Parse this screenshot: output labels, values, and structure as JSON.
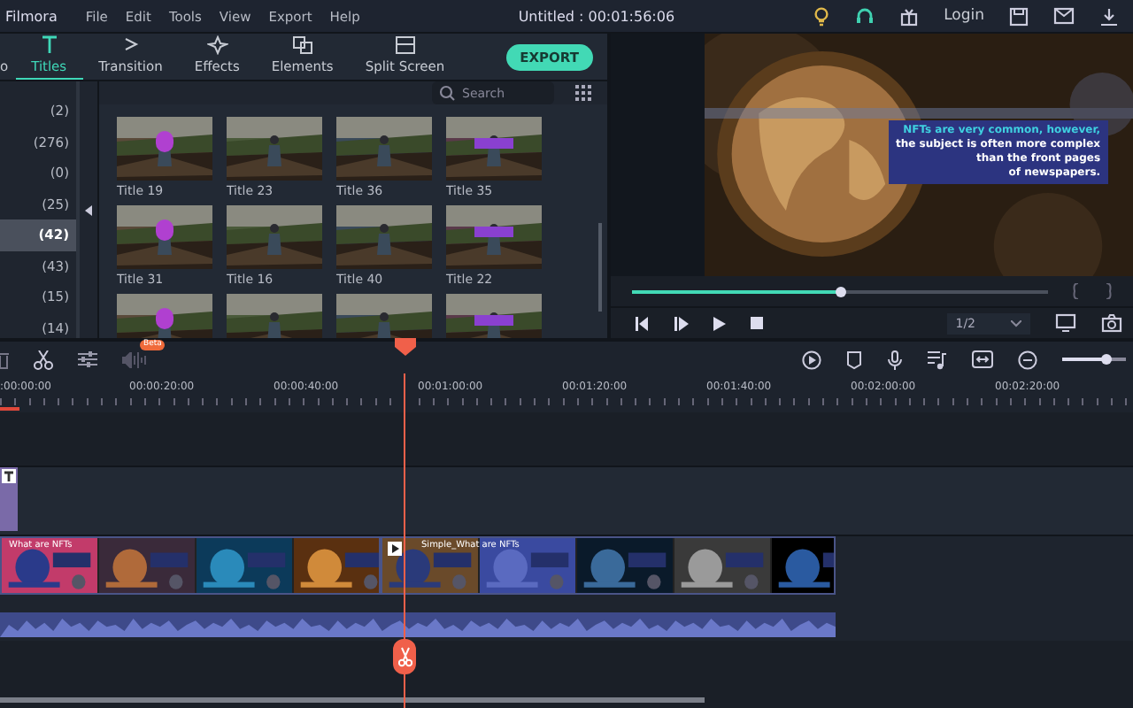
{
  "app": {
    "name": "Filmora"
  },
  "menu": [
    "File",
    "Edit",
    "Tools",
    "View",
    "Export",
    "Help"
  ],
  "project_title": "Untitled : 00:01:56:06",
  "login": "Login",
  "tabs": [
    {
      "label": "o",
      "selected": false
    },
    {
      "label": "Titles",
      "selected": true
    },
    {
      "label": "Transition",
      "selected": false
    },
    {
      "label": "Effects",
      "selected": false
    },
    {
      "label": "Elements",
      "selected": false
    },
    {
      "label": "Split Screen",
      "selected": false
    }
  ],
  "export_button": "EXPORT",
  "categories": [
    {
      "count": "(2)",
      "selected": false
    },
    {
      "count": "(276)",
      "selected": false
    },
    {
      "count": "(0)",
      "selected": false
    },
    {
      "count": "(25)",
      "selected": false
    },
    {
      "count": "(42)",
      "selected": true
    },
    {
      "count": "(43)",
      "selected": false
    },
    {
      "count": "(15)",
      "selected": false
    },
    {
      "count": "(14)",
      "selected": false
    }
  ],
  "search": {
    "placeholder": "Search"
  },
  "thumbnails": [
    {
      "label": "Title 19"
    },
    {
      "label": "Title 23"
    },
    {
      "label": "Title 36"
    },
    {
      "label": "Title 35"
    },
    {
      "label": "Title 31"
    },
    {
      "label": "Title 16"
    },
    {
      "label": "Title 40"
    },
    {
      "label": "Title 22"
    },
    {
      "kind": "picture"
    },
    {
      "kind": "picture"
    },
    {
      "kind": "picture"
    },
    {
      "kind": "picture"
    }
  ],
  "preview": {
    "caption_highlight": "NFTs are very common, however,",
    "caption_lines": [
      "the subject is often more complex",
      "than the front pages",
      "of newspapers."
    ],
    "progress": {
      "level": 0.5
    },
    "page": "1/2"
  },
  "timeline": {
    "beta_badge": "Beta",
    "zoom": {
      "level": 0.7
    },
    "ruler": [
      ":00:00:00",
      "00:00:20:00",
      "00:00:40:00",
      "00:01:00:00",
      "00:01:20:00",
      "00:01:40:00",
      "00:02:00:00",
      "00:02:20:00"
    ],
    "clips": [
      {
        "label": "What are NFTs"
      },
      {
        "label": "Simple_What are NFTs"
      }
    ]
  }
}
